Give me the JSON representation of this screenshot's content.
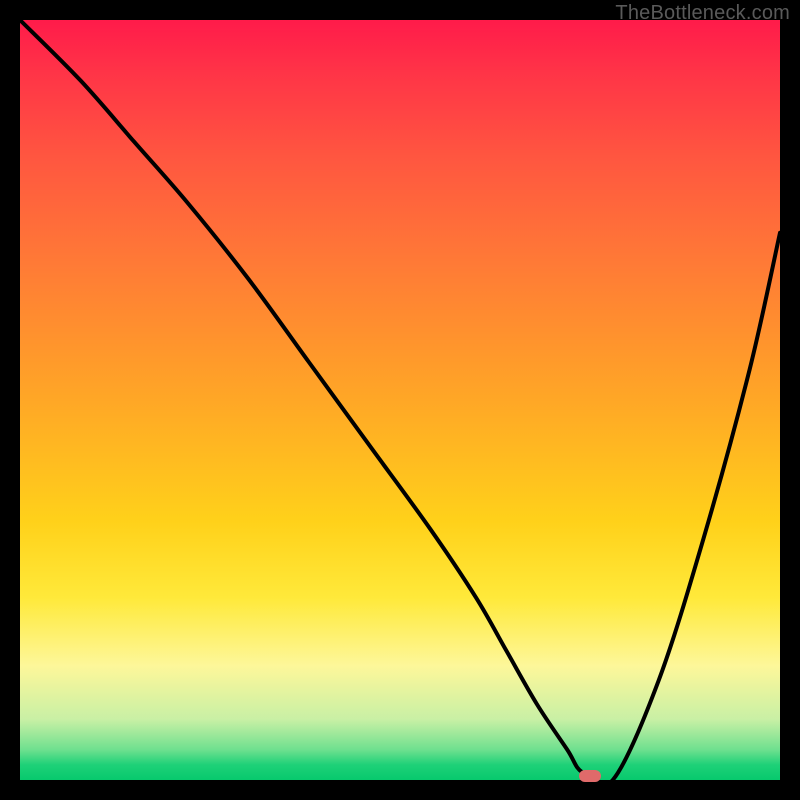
{
  "watermark": "TheBottleneck.com",
  "chart_data": {
    "type": "line",
    "title": "",
    "xlabel": "",
    "ylabel": "",
    "xlim": [
      0,
      100
    ],
    "ylim": [
      0,
      100
    ],
    "grid": false,
    "legend": null,
    "annotations": [],
    "background_gradient": {
      "direction": "top-to-bottom",
      "stops": [
        {
          "pos": 0,
          "meaning": "bottleneck-high",
          "color": "#ff1b4a"
        },
        {
          "pos": 50,
          "meaning": "bottleneck-mid",
          "color": "#ffa726"
        },
        {
          "pos": 85,
          "meaning": "bottleneck-low",
          "color": "#fdf79a"
        },
        {
          "pos": 100,
          "meaning": "bottleneck-none",
          "color": "#07c96d"
        }
      ]
    },
    "series": [
      {
        "name": "bottleneck-curve",
        "x": [
          0,
          8,
          15,
          22,
          30,
          38,
          46,
          54,
          60,
          64,
          68,
          72,
          74,
          78,
          84,
          90,
          96,
          100
        ],
        "y": [
          100,
          92,
          84,
          76,
          66,
          55,
          44,
          33,
          24,
          17,
          10,
          4,
          1,
          0,
          13,
          32,
          54,
          72
        ]
      }
    ],
    "marker": {
      "x": 75,
      "y": 0,
      "shape": "rounded-rect",
      "color": "#e06a6a"
    }
  }
}
